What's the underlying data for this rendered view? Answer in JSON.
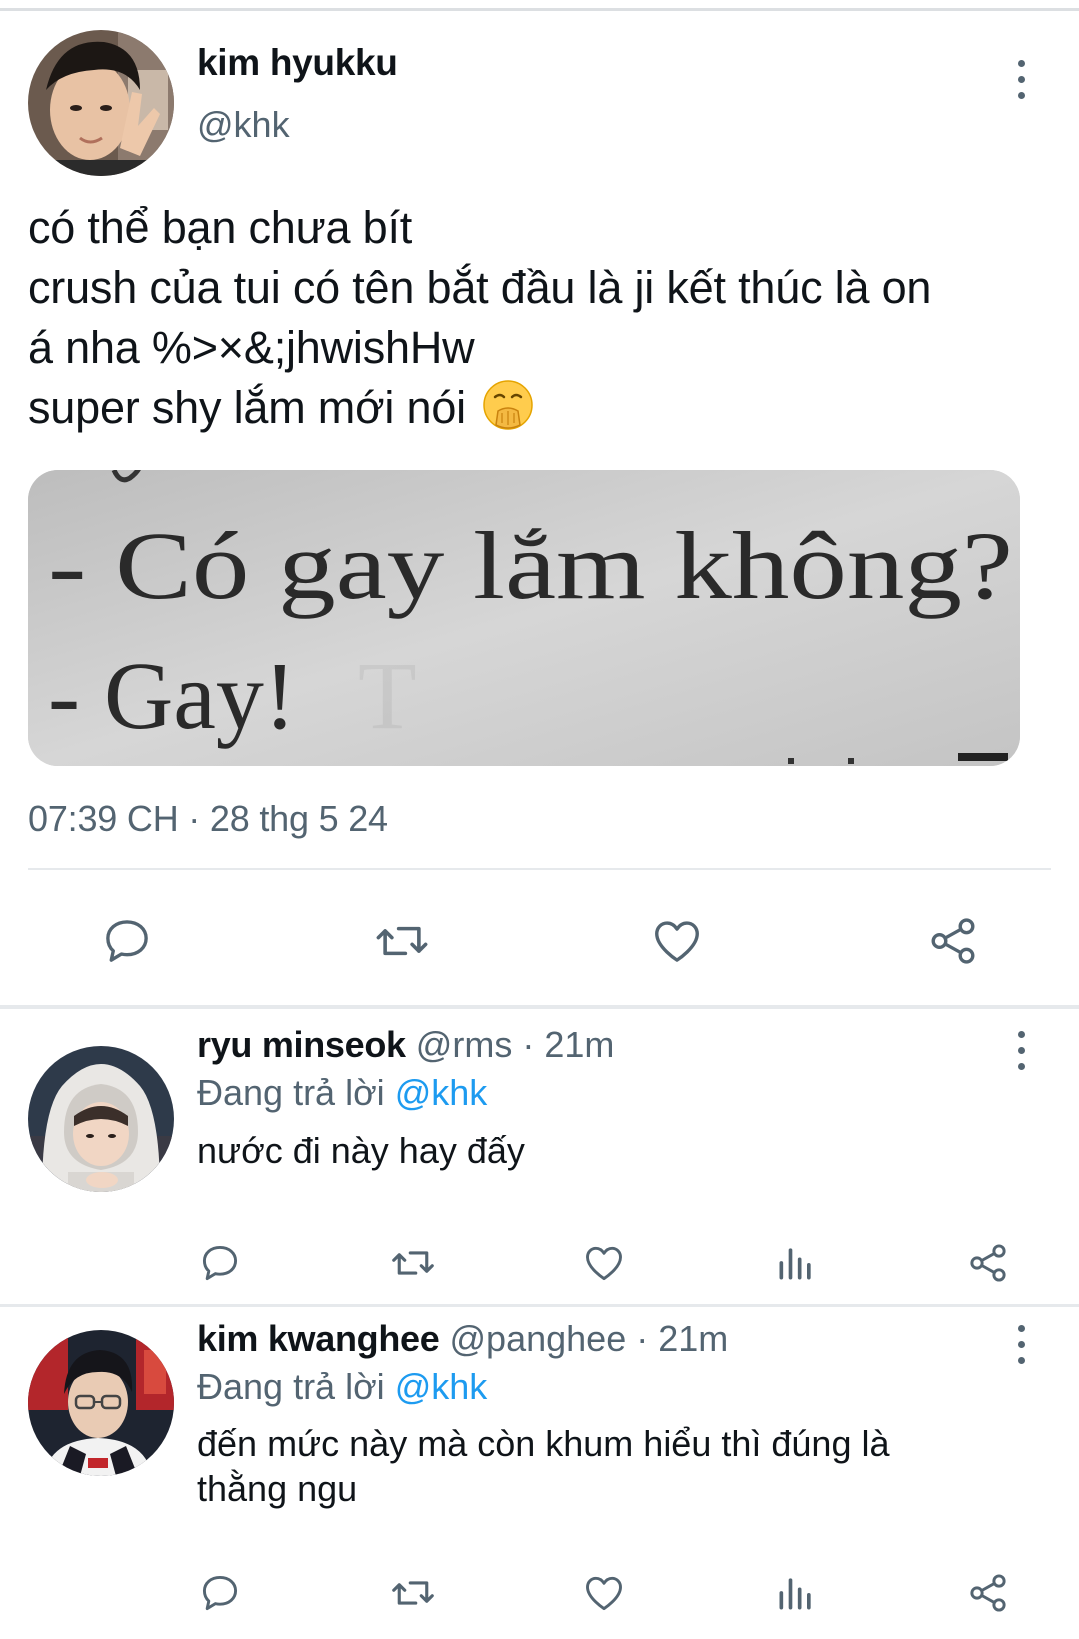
{
  "main_tweet": {
    "author_name": "kim hyukku",
    "author_handle": "@khk",
    "text_lines": [
      "có thể bạn chưa bít",
      "crush của tui có tên bắt đầu là ji kết thúc là on",
      "á nha %>×&;jhwishHw",
      "super shy lắm mới nói"
    ],
    "emoji": "face-with-hand-over-mouth",
    "media_text": {
      "line1": "- Có gay lắm không?",
      "line2": "- Gay!"
    },
    "timestamp": "07:39 CH · 28 thg 5 24",
    "actions": [
      "reply",
      "retweet",
      "like",
      "share"
    ]
  },
  "replies": [
    {
      "author_name": "ryu minseok",
      "author_handle": "@rms",
      "time": " · 21m",
      "replying_prefix": "Đang trả lời ",
      "replying_to": "@khk",
      "text": "nước đi này hay đấy",
      "actions": [
        "reply",
        "retweet",
        "like",
        "views",
        "share"
      ]
    },
    {
      "author_name": "kim kwanghee",
      "author_handle": "@panghee",
      "time": " · 21m",
      "replying_prefix": "Đang trả lời ",
      "replying_to": "@khk",
      "text_line1": "đến mức này mà còn khum hiểu thì đúng là",
      "text_line2": "thằng ngu",
      "actions": [
        "reply",
        "retweet",
        "like",
        "views",
        "share"
      ]
    }
  ],
  "colors": {
    "text": "#0f1419",
    "secondary": "#536471",
    "link": "#1d9bf0",
    "divider": "#e6e9ec"
  }
}
